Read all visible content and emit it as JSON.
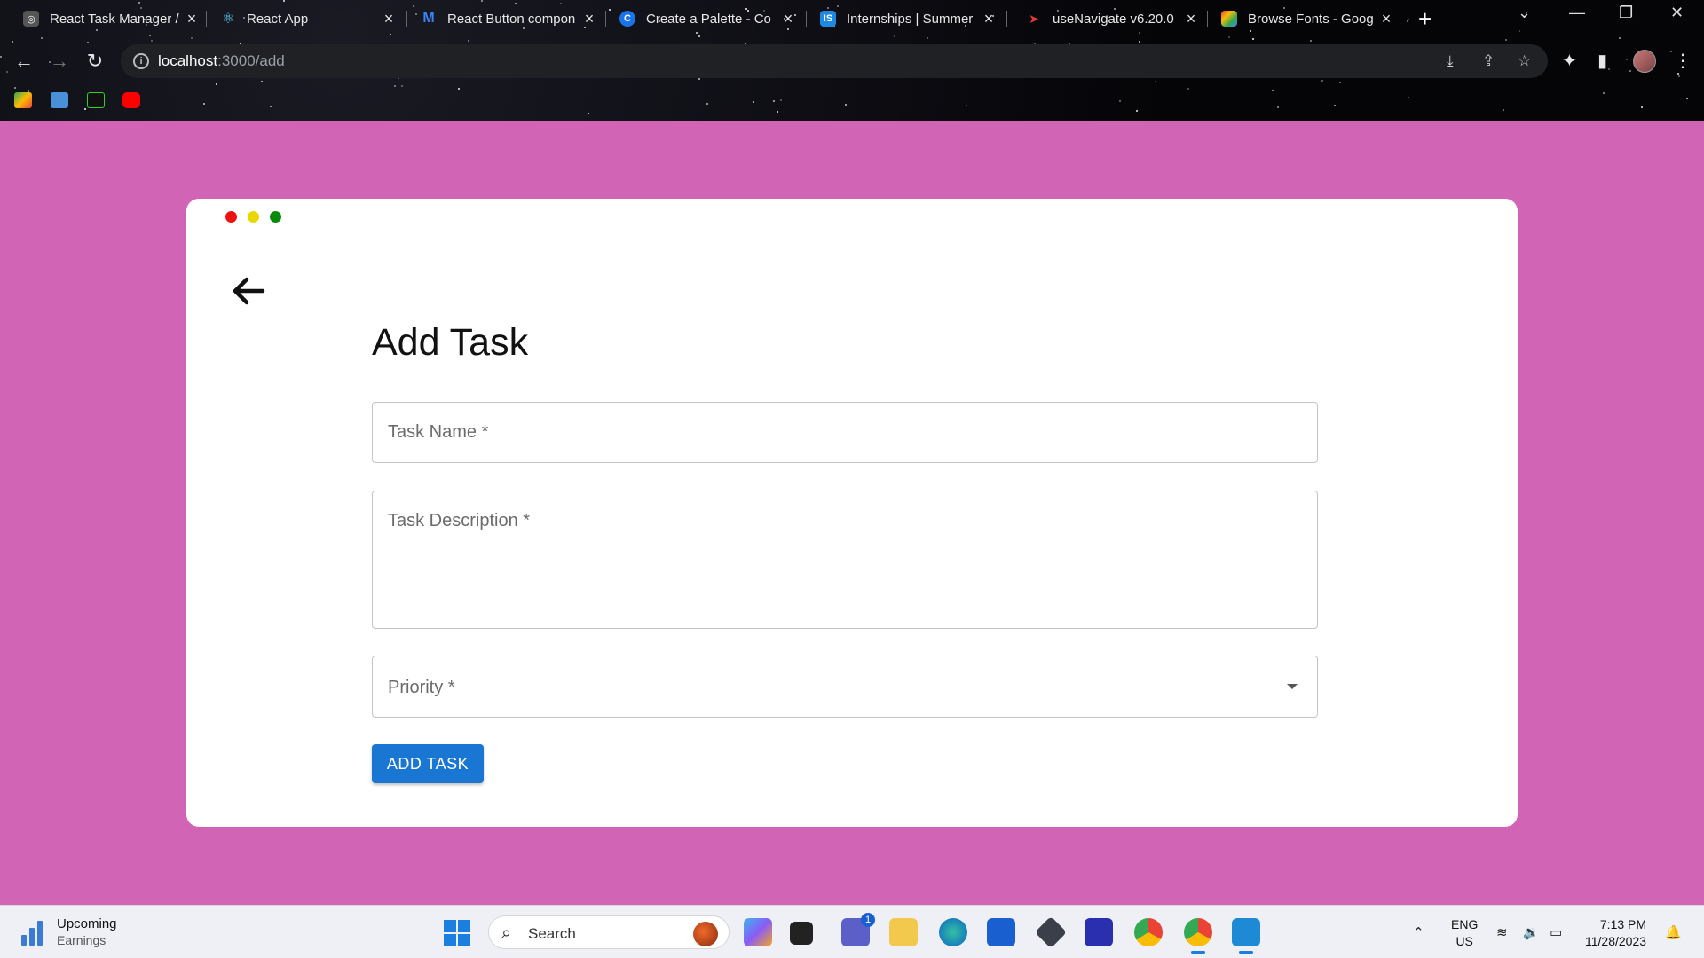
{
  "browser": {
    "tabs": [
      {
        "title": "React Task Manager /",
        "color": "#3a3a3a"
      },
      {
        "title": "React App",
        "color": "#0b1d2a"
      },
      {
        "title": "React Button compon",
        "color": "#0a2a6a"
      },
      {
        "title": "Create a Palette - Co",
        "color": "#1a73e8"
      },
      {
        "title": "Internships | Summer",
        "color": "#1e88e5"
      },
      {
        "title": "useNavigate v6.20.0",
        "color": "#c62828"
      },
      {
        "title": "Browse Fonts - Goog",
        "color": "#34a853"
      }
    ],
    "url_host": "localhost",
    "url_path": ":3000/add"
  },
  "page": {
    "title": "Add Task",
    "fields": {
      "task_name_label": "Task Name *",
      "task_description_label": "Task Description *",
      "priority_label": "Priority *"
    },
    "submit_label": "ADD TASK",
    "window_dots": [
      "#ee1111",
      "#e8d800",
      "#0a8a0a"
    ]
  },
  "taskbar": {
    "weather_title": "Upcoming",
    "weather_subtitle": "Earnings",
    "search_label": "Search",
    "chat_badge": "1",
    "lang_line1": "ENG",
    "lang_line2": "US",
    "time": "7:13 PM",
    "date": "11/28/2023"
  }
}
